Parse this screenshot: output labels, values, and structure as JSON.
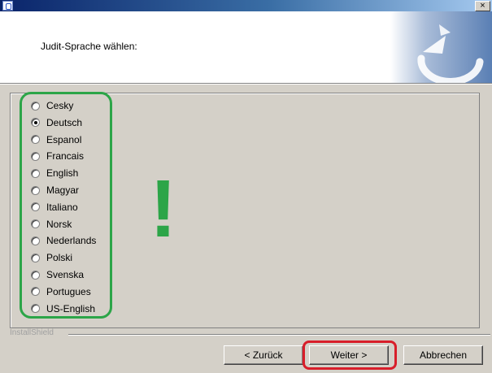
{
  "window": {
    "close_label": "×"
  },
  "header": {
    "title": "Judit-Sprache wählen:"
  },
  "languages": [
    {
      "label": "Cesky",
      "checked": false
    },
    {
      "label": "Deutsch",
      "checked": true
    },
    {
      "label": "Espanol",
      "checked": false
    },
    {
      "label": "Francais",
      "checked": false
    },
    {
      "label": "English",
      "checked": false
    },
    {
      "label": "Magyar",
      "checked": false
    },
    {
      "label": "Italiano",
      "checked": false
    },
    {
      "label": "Norsk",
      "checked": false
    },
    {
      "label": "Nederlands",
      "checked": false
    },
    {
      "label": "Polski",
      "checked": false
    },
    {
      "label": "Svenska",
      "checked": false
    },
    {
      "label": "Portugues",
      "checked": false
    },
    {
      "label": "US-English",
      "checked": false
    }
  ],
  "annotation": {
    "exclamation": "!",
    "highlight_color_green": "#2ca548",
    "highlight_color_red": "#d81e2a"
  },
  "footer": {
    "brand_label": "InstallShield",
    "back_label": "< Zurück",
    "next_label": "Weiter >",
    "cancel_label": "Abbrechen"
  }
}
